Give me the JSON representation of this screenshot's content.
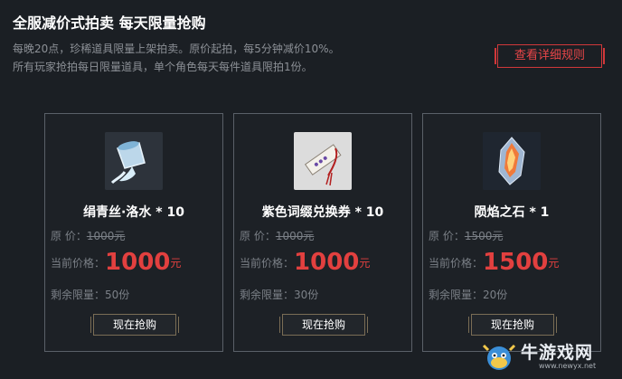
{
  "header": {
    "title": "全服减价式拍卖 每天限量抢购",
    "desc_line1": "每晚20点，珍稀道具限量上架拍卖。原价起拍，每5分钟减价10%。",
    "desc_line2": "所有玩家抢拍每日限量道具，单个角色每天每件道具限拍1份。",
    "rules_button": "查看详细规则"
  },
  "labels": {
    "original_prefix": "原 价：",
    "current_prefix": "当前价格：",
    "remain_prefix": "剩余限量：",
    "currency": "元",
    "buy_button": "现在抢购"
  },
  "items": [
    {
      "name": "绢青丝·洛水 * 10",
      "original": "1000元",
      "current": "1000",
      "remain": "50份",
      "icon": "water-cup-icon"
    },
    {
      "name": "紫色词缀兑换券 * 10",
      "original": "1000元",
      "current": "1000",
      "remain": "30份",
      "icon": "voucher-bookmark-icon"
    },
    {
      "name": "陨焰之石 * 1",
      "original": "1500元",
      "current": "1500",
      "remain": "20份",
      "icon": "flame-crystal-icon"
    }
  ],
  "watermark": {
    "text": "牛游戏网",
    "url": "www.newyx.net"
  }
}
